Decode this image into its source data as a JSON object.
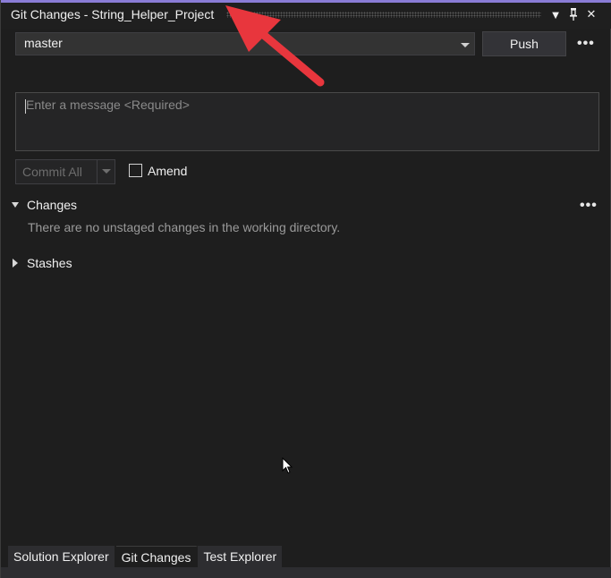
{
  "window": {
    "title": "Git Changes - String_Helper_Project",
    "dropdown_icon": "▼",
    "pin_icon": "pin-icon",
    "close_icon": "✕"
  },
  "branch": {
    "selected": "master"
  },
  "push_label": "Push",
  "more_icon": "•••",
  "commit_message": {
    "placeholder": "Enter a message <Required>"
  },
  "commit_all_label": "Commit All",
  "amend_label": "Amend",
  "changes_section": {
    "title": "Changes",
    "empty_message": "There are no unstaged changes in the working directory."
  },
  "stashes_section": {
    "title": "Stashes"
  },
  "tabs": [
    {
      "label": "Solution Explorer"
    },
    {
      "label": "Git Changes"
    },
    {
      "label": "Test Explorer"
    }
  ],
  "colors": {
    "accent": "#8a7cd6",
    "annotation_arrow": "#e8363d",
    "background": "#1e1e1e"
  }
}
